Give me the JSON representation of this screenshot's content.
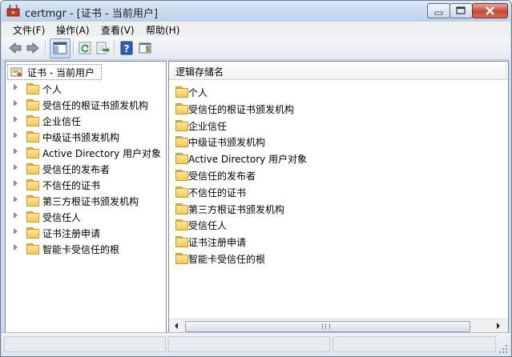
{
  "window": {
    "title": "certmgr - [证书 - 当前用户]",
    "controls": [
      "minimize",
      "maximize",
      "close"
    ]
  },
  "menubar": {
    "items": [
      {
        "label": "文件(F)"
      },
      {
        "label": "操作(A)"
      },
      {
        "label": "查看(V)"
      },
      {
        "label": "帮助(H)"
      }
    ]
  },
  "toolbar": {
    "icons": [
      "back-arrow-icon",
      "forward-arrow-icon",
      "show-hide-console-tree-icon",
      "refresh-icon",
      "export-list-icon",
      "help-icon",
      "show-action-pane-icon"
    ]
  },
  "tree": {
    "root_label": "证书 - 当前用户",
    "items": [
      {
        "label": "个人"
      },
      {
        "label": "受信任的根证书颁发机构"
      },
      {
        "label": "企业信任"
      },
      {
        "label": "中级证书颁发机构"
      },
      {
        "label": "Active Directory 用户对象"
      },
      {
        "label": "受信任的发布者"
      },
      {
        "label": "不信任的证书"
      },
      {
        "label": "第三方根证书颁发机构"
      },
      {
        "label": "受信任人"
      },
      {
        "label": "证书注册申请"
      },
      {
        "label": "智能卡受信任的根"
      }
    ]
  },
  "list": {
    "column_header": "逻辑存储名",
    "items": [
      {
        "label": "个人"
      },
      {
        "label": "受信任的根证书颁发机构"
      },
      {
        "label": "企业信任"
      },
      {
        "label": "中级证书颁发机构"
      },
      {
        "label": "Active Directory 用户对象"
      },
      {
        "label": "受信任的发布者"
      },
      {
        "label": "不信任的证书"
      },
      {
        "label": "第三方根证书颁发机构"
      },
      {
        "label": "受信任人"
      },
      {
        "label": "证书注册申请"
      },
      {
        "label": "智能卡受信任的根"
      }
    ]
  },
  "colors": {
    "title_bar": "#c9daeb",
    "folder": "#f3c94e",
    "close_button": "#c44a36"
  }
}
